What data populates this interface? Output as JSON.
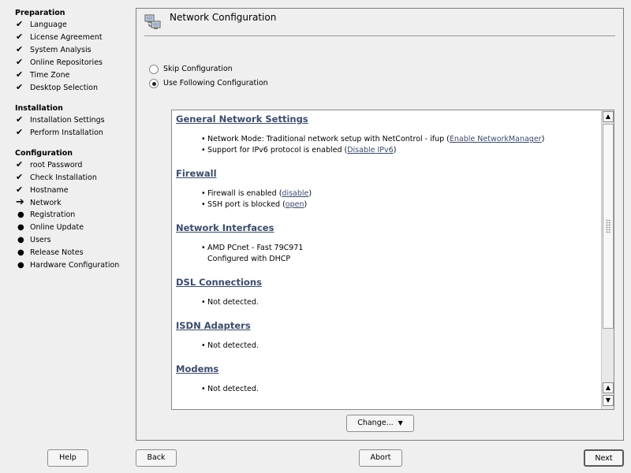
{
  "sidebar": {
    "sections": [
      {
        "title": "Preparation",
        "items": [
          {
            "label": "Language",
            "state": "done"
          },
          {
            "label": "License Agreement",
            "state": "done"
          },
          {
            "label": "System Analysis",
            "state": "done"
          },
          {
            "label": "Online Repositories",
            "state": "done"
          },
          {
            "label": "Time Zone",
            "state": "done"
          },
          {
            "label": "Desktop Selection",
            "state": "done"
          }
        ]
      },
      {
        "title": "Installation",
        "items": [
          {
            "label": "Installation Settings",
            "state": "done"
          },
          {
            "label": "Perform Installation",
            "state": "done"
          }
        ]
      },
      {
        "title": "Configuration",
        "items": [
          {
            "label": "root Password",
            "state": "done"
          },
          {
            "label": "Check Installation",
            "state": "done"
          },
          {
            "label": "Hostname",
            "state": "done"
          },
          {
            "label": "Network",
            "state": "current"
          },
          {
            "label": "Registration",
            "state": "todo"
          },
          {
            "label": "Online Update",
            "state": "todo"
          },
          {
            "label": "Users",
            "state": "todo"
          },
          {
            "label": "Release Notes",
            "state": "todo"
          },
          {
            "label": "Hardware Configuration",
            "state": "todo"
          }
        ]
      }
    ],
    "glyphs": {
      "done": "✔",
      "current": "➔",
      "todo": "●"
    }
  },
  "main": {
    "title": "Network Configuration",
    "options": [
      {
        "label": "Skip Configuration",
        "selected": false
      },
      {
        "label": "Use Following Configuration",
        "selected": true
      }
    ],
    "summary": {
      "sections": [
        {
          "heading": "General Network Settings",
          "items": [
            {
              "text": "Network Mode: Traditional network setup with NetControl - ifup (",
              "link": "Enable NetworkManager",
              "after": ")"
            },
            {
              "text": "Support for IPv6 protocol is enabled (",
              "link": "Disable IPv6",
              "after": ")"
            }
          ]
        },
        {
          "heading": "Firewall",
          "items": [
            {
              "text": "Firewall is enabled (",
              "link": "disable",
              "after": ")"
            },
            {
              "text": "SSH port is blocked (",
              "link": "open",
              "after": ")"
            }
          ]
        },
        {
          "heading": "Network Interfaces",
          "items": [
            {
              "text": "AMD PCnet - Fast 79C971"
            },
            {
              "text": "Configured with DHCP",
              "nobullet": true
            }
          ]
        },
        {
          "heading": "DSL Connections",
          "items": [
            {
              "text": "Not detected."
            }
          ]
        },
        {
          "heading": "ISDN Adapters",
          "items": [
            {
              "text": "Not detected."
            }
          ]
        },
        {
          "heading": "Modems",
          "items": [
            {
              "text": "Not detected."
            }
          ]
        }
      ]
    },
    "change_button": "Change..."
  },
  "buttons": {
    "help": "Help",
    "back": "Back",
    "abort": "Abort",
    "next": "Next"
  },
  "colors": {
    "heading": "#3b4b6b",
    "link": "#3b4b6b"
  }
}
